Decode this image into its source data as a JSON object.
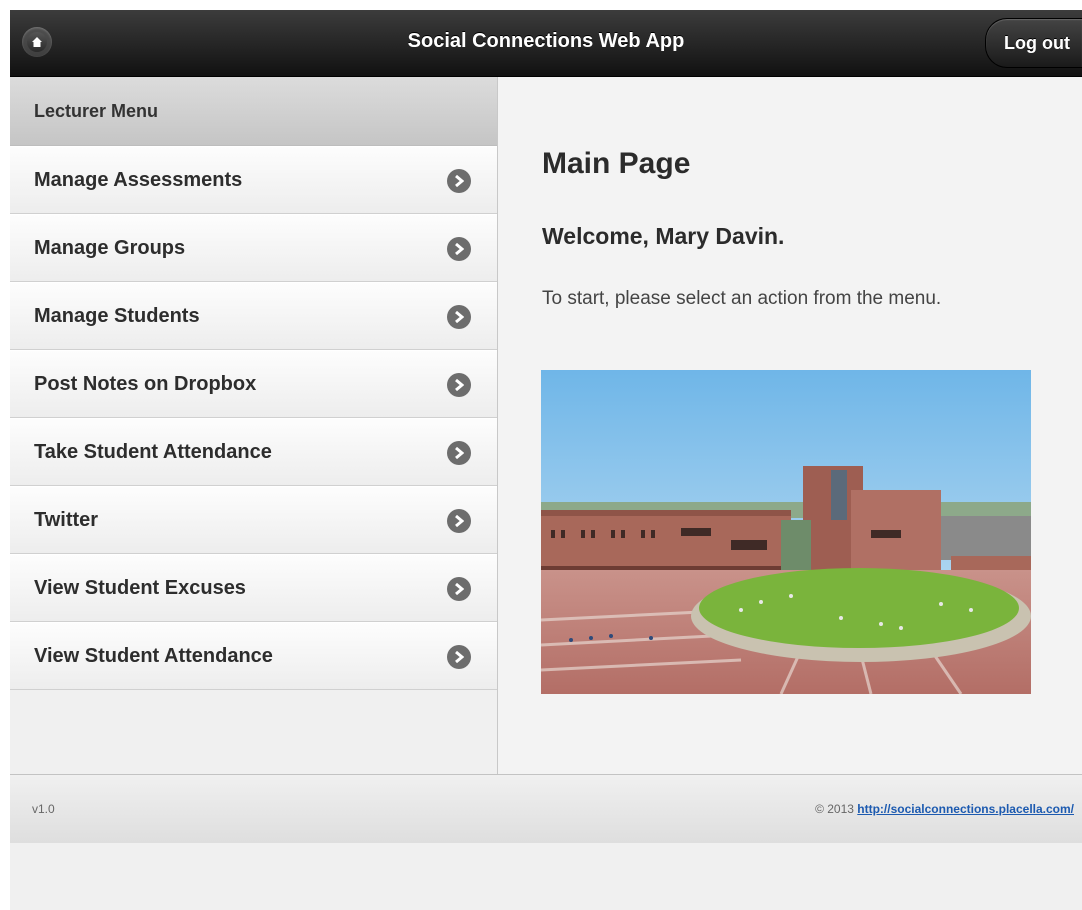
{
  "header": {
    "title": "Social Connections Web App",
    "logout_label": "Log out",
    "home_icon": "home-icon"
  },
  "sidebar": {
    "heading": "Lecturer Menu",
    "items": [
      {
        "label": "Manage Assessments"
      },
      {
        "label": "Manage Groups"
      },
      {
        "label": "Manage Students"
      },
      {
        "label": "Post Notes on Dropbox"
      },
      {
        "label": "Take Student Attendance"
      },
      {
        "label": "Twitter"
      },
      {
        "label": "View Student Excuses"
      },
      {
        "label": "View Student Attendance"
      }
    ]
  },
  "main": {
    "title": "Main Page",
    "welcome": "Welcome, Mary Davin.",
    "instructions": "To start, please select an action from the menu."
  },
  "footer": {
    "version": "v1.0",
    "copyright_prefix": "© 2013",
    "link_text": "http://socialconnections.placella.com/"
  },
  "colors": {
    "header_bg": "#1a1a1a",
    "link": "#1c5ab0",
    "arrow": "#6d6d6d"
  }
}
